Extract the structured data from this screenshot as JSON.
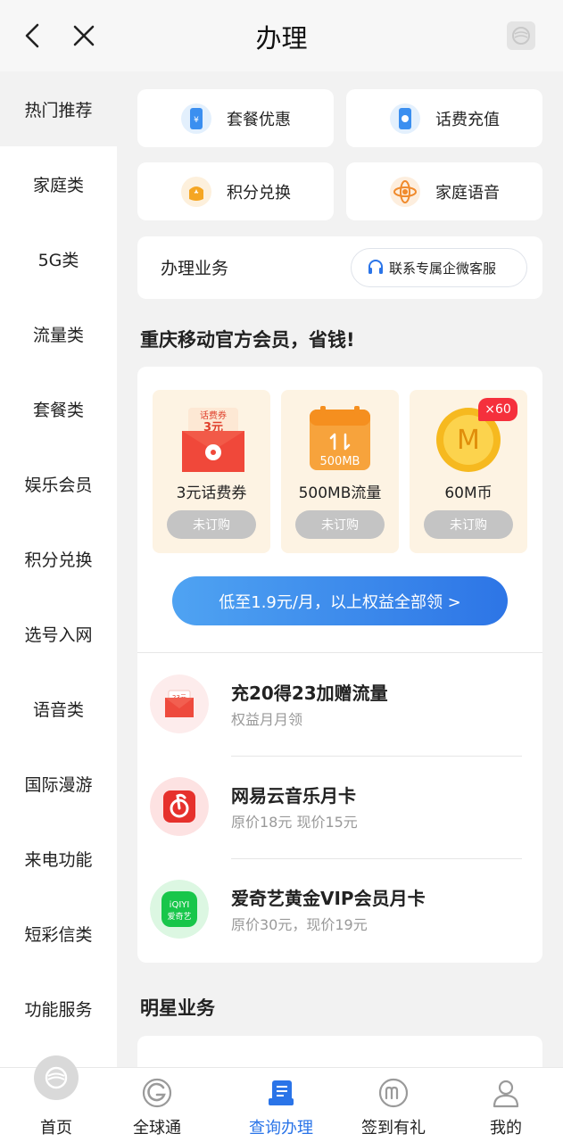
{
  "header": {
    "title": "办理"
  },
  "sidebar": {
    "items": [
      {
        "label": "热门推荐",
        "active": true
      },
      {
        "label": "家庭类"
      },
      {
        "label": "5G类"
      },
      {
        "label": "流量类"
      },
      {
        "label": "套餐类"
      },
      {
        "label": "娱乐会员"
      },
      {
        "label": "积分兑换"
      },
      {
        "label": "选号入网"
      },
      {
        "label": "语音类"
      },
      {
        "label": "国际漫游"
      },
      {
        "label": "来电功能"
      },
      {
        "label": "短彩信类"
      },
      {
        "label": "功能服务"
      }
    ]
  },
  "quick_actions": [
    {
      "label": "套餐优惠",
      "icon": "phone-yuan-icon"
    },
    {
      "label": "话费充值",
      "icon": "phone-charge-icon"
    },
    {
      "label": "积分兑换",
      "icon": "points-bag-icon"
    },
    {
      "label": "家庭语音",
      "icon": "family-voice-icon"
    }
  ],
  "business": {
    "label": "办理业务",
    "contact_button": "联系专属企微客服"
  },
  "membership": {
    "title": "重庆移动官方会员，省钱!",
    "benefits": [
      {
        "name": "3元话费券",
        "status": "未订购",
        "coupon_tag": "话费券",
        "coupon_value": "3元"
      },
      {
        "name": "500MB流量",
        "status": "未订购",
        "image_text": "500MB"
      },
      {
        "name": "60M币",
        "status": "未订购",
        "image_text": "M",
        "badge": "×60"
      }
    ],
    "cta": "低至1.9元/月，以上权益全部领 >"
  },
  "promos": [
    {
      "title": "充20得23加赠流量",
      "subtitle": "权益月月领",
      "icon": "red-envelope-icon",
      "icon_text": "23元"
    },
    {
      "title": "网易云音乐月卡",
      "subtitle": "原价18元 现价15元",
      "icon": "netease-music-icon"
    },
    {
      "title": "爱奇艺黄金VIP会员月卡",
      "subtitle": "原价30元，现价19元",
      "icon": "iqiyi-icon",
      "icon_text_1": "iQIYI",
      "icon_text_2": "爱奇艺"
    }
  ],
  "star_business": {
    "title": "明星业务"
  },
  "tabbar": {
    "items": [
      {
        "label": "首页",
        "icon": "china-mobile-logo-icon"
      },
      {
        "label": "全球通",
        "icon": "globe-g-icon"
      },
      {
        "label": "查询办理",
        "icon": "query-document-icon",
        "active": true
      },
      {
        "label": "签到有礼",
        "icon": "checkin-m-icon"
      },
      {
        "label": "我的",
        "icon": "user-profile-icon"
      }
    ]
  },
  "colors": {
    "accent": "#2a74e8",
    "benefit_bg": "#fdf3e3",
    "status_gray": "#c4c4c4",
    "badge_red": "#f5303c"
  }
}
